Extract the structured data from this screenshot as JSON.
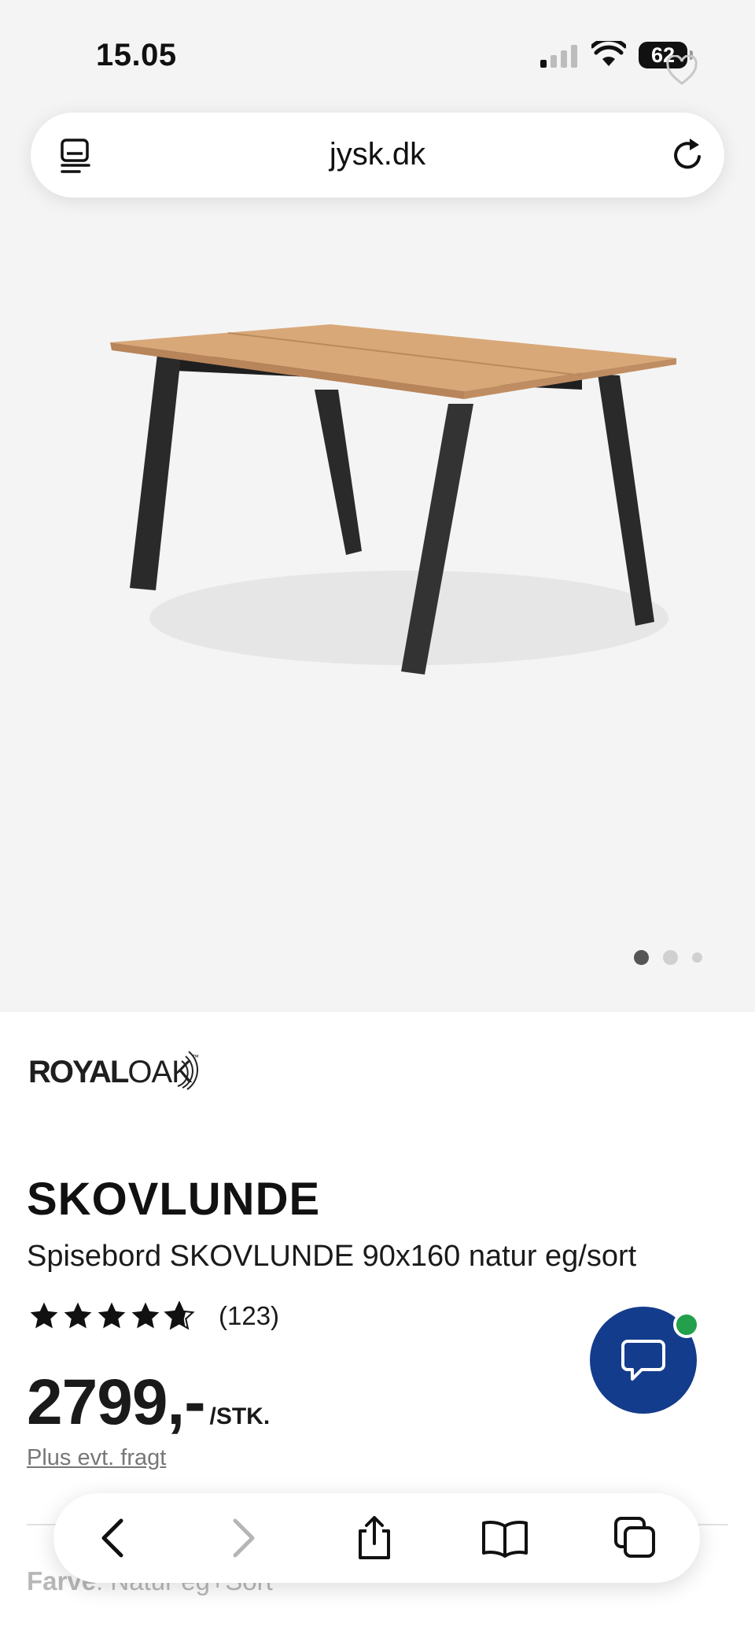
{
  "status_bar": {
    "time": "15.05",
    "battery": "62"
  },
  "browser": {
    "url": "jysk.dk",
    "icons": [
      "reader-icon",
      "reload-icon",
      "heart-icon",
      "back-icon",
      "forward-icon",
      "share-icon",
      "bookmarks-icon",
      "tabs-icon"
    ]
  },
  "gallery": {
    "image_alt": "Spisebord SKOVLUNDE",
    "slides": 3,
    "active_slide": 1
  },
  "product": {
    "brand_royal": "ROYAL",
    "brand_oak": "OAK",
    "brand_tm": "™",
    "name": "SKOVLUNDE",
    "description": "Spisebord SKOVLUNDE 90x160 natur eg/sort",
    "rating": 4.5,
    "rating_count": "(123)",
    "price": "2799,-",
    "price_unit": "/STK.",
    "shipping_note": "Plus evt. fragt",
    "color_label": "Farve",
    "color_value": ": Natur eg+Sort"
  },
  "colors": {
    "chat_button": "#143c8c",
    "online_dot": "#22a04b",
    "tabletop": "#d9a878",
    "legs": "#2a2a2a"
  }
}
